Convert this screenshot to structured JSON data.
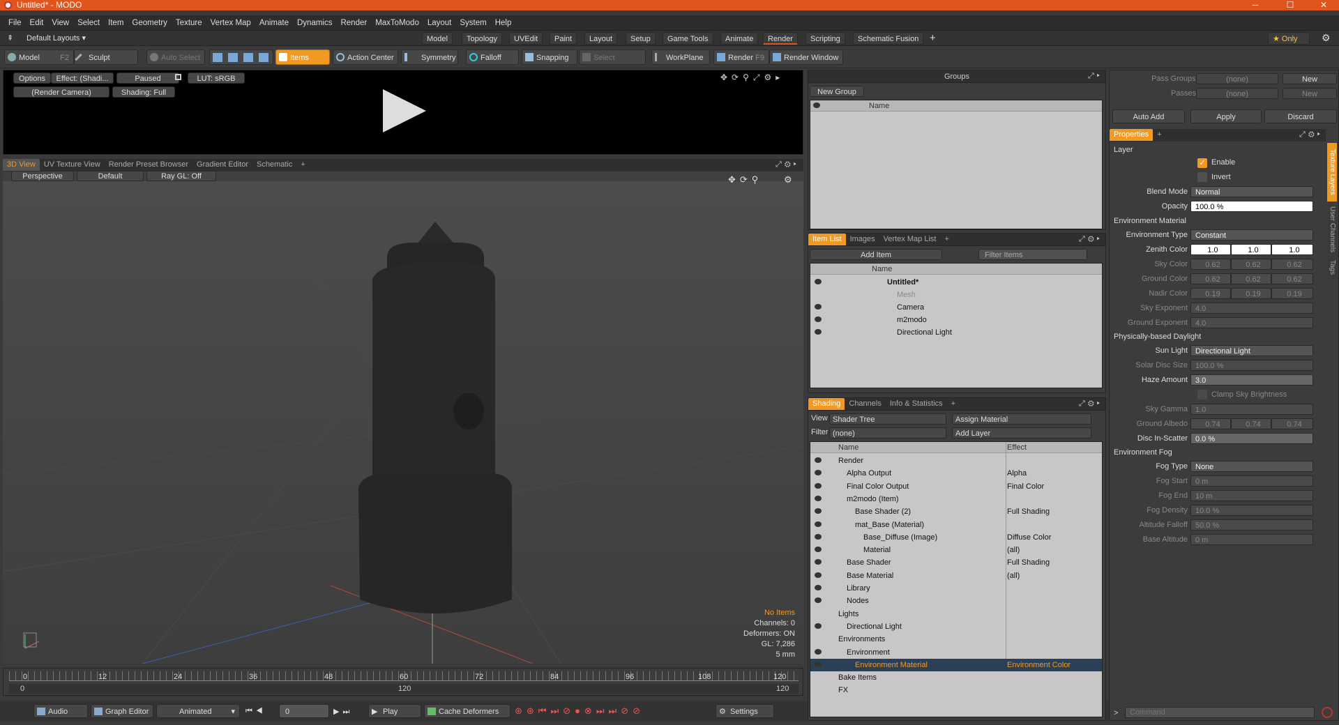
{
  "window": {
    "title": "Untitled* - MODO"
  },
  "menu": [
    "File",
    "Edit",
    "View",
    "Select",
    "Item",
    "Geometry",
    "Texture",
    "Vertex Map",
    "Animate",
    "Dynamics",
    "Render",
    "MaxToModo",
    "Layout",
    "System",
    "Help"
  ],
  "layout_bar": {
    "default_layouts": "Default Layouts ▾",
    "tabs": [
      "Model",
      "Topology",
      "UVEdit",
      "Paint",
      "Layout",
      "Setup",
      "Game Tools",
      "Animate",
      "Render",
      "Scripting",
      "Schematic Fusion"
    ],
    "active_tab": "Render",
    "only_label": "★ Only"
  },
  "toolbar": {
    "model": "Model",
    "model_key": "F2",
    "sculpt": "Sculpt",
    "auto_select": "Auto Select",
    "items": "Items",
    "action_center": "Action Center",
    "symmetry": "Symmetry",
    "falloff": "Falloff",
    "snapping": "Snapping",
    "select_through": "Select Through",
    "workplane": "WorkPlane",
    "render": "Render",
    "render_key": "F9",
    "render_window": "Render Window"
  },
  "render_preview": {
    "options": "Options",
    "effect": "Effect: (Shadi...",
    "paused": "Paused",
    "lut": "LUT: sRGB",
    "camera": "(Render Camera)",
    "shading": "Shading: Full"
  },
  "view_tabs": [
    "3D View",
    "UV Texture View",
    "Render Preset Browser",
    "Gradient Editor",
    "Schematic"
  ],
  "viewport": {
    "perspective": "Perspective",
    "default": "Default",
    "raygl": "Ray GL: Off",
    "info": {
      "no_items": "No Items",
      "channels": "Channels: 0",
      "deformers": "Deformers: ON",
      "gl": "GL: 7,286",
      "scale": "5 mm"
    }
  },
  "timeline": {
    "ticks": [
      "0",
      "12",
      "24",
      "36",
      "48",
      "60",
      "72",
      "84",
      "96",
      "108",
      "120"
    ],
    "sub_left": "0",
    "sub_mid": "120",
    "sub_right": "120"
  },
  "bottom_bar": {
    "audio": "Audio",
    "graph_editor": "Graph Editor",
    "animated": "Animated",
    "frame": "0",
    "play": "Play",
    "cache": "Cache Deformers",
    "settings": "Settings"
  },
  "groups": {
    "title": "Groups",
    "new_group": "New Group",
    "name_col": "Name"
  },
  "item_list": {
    "tabs": [
      "Item List",
      "Images",
      "Vertex Map List"
    ],
    "add_item": "Add Item",
    "filter": "Filter Items",
    "name_col": "Name",
    "items": [
      {
        "label": "Untitled*"
      },
      {
        "label": "Mesh"
      },
      {
        "label": "Camera"
      },
      {
        "label": "m2modo"
      },
      {
        "label": "Directional Light"
      }
    ]
  },
  "shading": {
    "tabs": [
      "Shading",
      "Channels",
      "Info & Statistics"
    ],
    "view_label": "View",
    "view_value": "Shader Tree",
    "assign": "Assign Material",
    "filter_label": "Filter",
    "filter_value": "(none)",
    "add_layer": "Add Layer",
    "name_col": "Name",
    "effect_col": "Effect",
    "rows": [
      {
        "label": "Render",
        "effect": "",
        "indent": 0
      },
      {
        "label": "Alpha Output",
        "effect": "Alpha",
        "indent": 1
      },
      {
        "label": "Final Color Output",
        "effect": "Final Color",
        "indent": 1
      },
      {
        "label": "m2modo (Item)",
        "effect": "",
        "indent": 1
      },
      {
        "label": "Base Shader (2)",
        "effect": "Full Shading",
        "indent": 2
      },
      {
        "label": "mat_Base (Material)",
        "effect": "",
        "indent": 2
      },
      {
        "label": "Base_Diffuse (Image)",
        "effect": "Diffuse Color",
        "indent": 3
      },
      {
        "label": "Material",
        "effect": "(all)",
        "indent": 3
      },
      {
        "label": "Base Shader",
        "effect": "Full Shading",
        "indent": 1
      },
      {
        "label": "Base Material",
        "effect": "(all)",
        "indent": 1
      },
      {
        "label": "Library",
        "effect": "",
        "indent": 1
      },
      {
        "label": "Nodes",
        "effect": "",
        "indent": 1
      },
      {
        "label": "Lights",
        "effect": "",
        "indent": 0
      },
      {
        "label": "Directional Light",
        "effect": "",
        "indent": 1
      },
      {
        "label": "Environments",
        "effect": "",
        "indent": 0
      },
      {
        "label": "Environment",
        "effect": "",
        "indent": 1
      },
      {
        "label": "Environment Material",
        "effect": "Environment Color",
        "indent": 2,
        "selected": true
      },
      {
        "label": "Bake Items",
        "effect": "",
        "indent": 0
      },
      {
        "label": "FX",
        "effect": "",
        "indent": 0
      }
    ]
  },
  "passes": {
    "pass_groups": "Pass Groups",
    "passes": "Passes",
    "none": "(none)",
    "new": "New",
    "auto_add": "Auto Add",
    "apply": "Apply",
    "discard": "Discard"
  },
  "properties": {
    "tab": "Properties",
    "side_tabs": [
      "Texture Layers",
      "User Channels",
      "Tags"
    ],
    "layer_section": "Layer",
    "enable": "Enable",
    "invert": "Invert",
    "blend_mode": "Blend Mode",
    "blend_value": "Normal",
    "opacity": "Opacity",
    "opacity_value": "100.0 %",
    "env_section": "Environment Material",
    "env_type": "Environment Type",
    "env_type_value": "Constant",
    "zenith": "Zenith Color",
    "zenith_vals": [
      "1.0",
      "1.0",
      "1.0"
    ],
    "sky": "Sky Color",
    "sky_vals": [
      "0.62",
      "0.62",
      "0.62"
    ],
    "ground": "Ground Color",
    "ground_vals": [
      "0.62",
      "0.62",
      "0.62"
    ],
    "nadir": "Nadir Color",
    "nadir_vals": [
      "0.19",
      "0.19",
      "0.19"
    ],
    "sky_exp": "Sky Exponent",
    "sky_exp_value": "4.0",
    "ground_exp": "Ground Exponent",
    "ground_exp_value": "4.0",
    "daylight_section": "Physically-based Daylight",
    "sun_light": "Sun Light",
    "sun_light_value": "Directional Light",
    "solar_disc": "Solar Disc Size",
    "solar_disc_value": "100.0 %",
    "haze": "Haze Amount",
    "haze_value": "3.0",
    "clamp": "Clamp Sky Brightness",
    "sky_gamma": "Sky Gamma",
    "sky_gamma_value": "1.0",
    "albedo": "Ground Albedo",
    "albedo_vals": [
      "0.74",
      "0.74",
      "0.74"
    ],
    "disc_in": "Disc In-Scatter",
    "disc_in_value": "0.0 %",
    "fog_section": "Environment Fog",
    "fog_type": "Fog Type",
    "fog_type_value": "None",
    "fog_start": "Fog Start",
    "fog_start_value": "0 m",
    "fog_end": "Fog End",
    "fog_end_value": "10 m",
    "fog_density": "Fog Density",
    "fog_density_value": "10.0 %",
    "alt_falloff": "Altitude Falloff",
    "alt_falloff_value": "50.0 %",
    "base_alt": "Base Altitude",
    "base_alt_value": "0 m"
  },
  "command": {
    "placeholder": "Command"
  }
}
